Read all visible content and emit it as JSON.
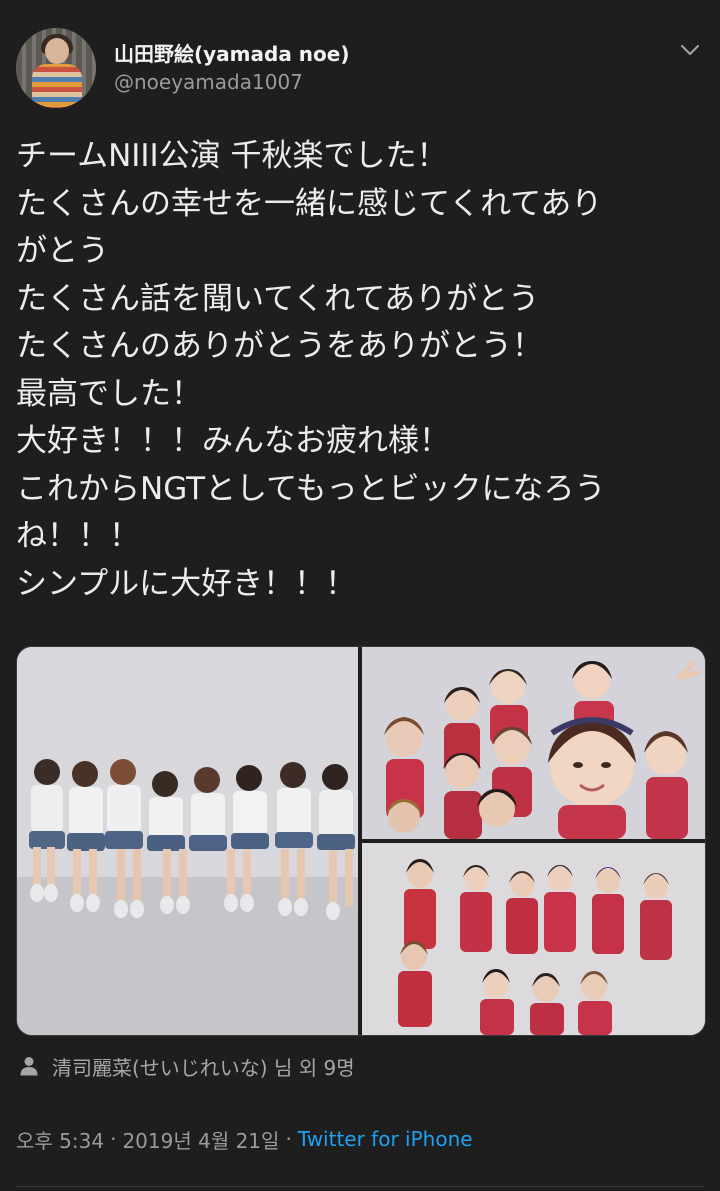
{
  "author": {
    "display_name": "山田野絵(yamada noe)",
    "handle": "@noeyamada1007"
  },
  "tweet": {
    "text": "チームNIII公演 千秋楽でした！\nたくさんの幸せを一緒に感じてくれてあり\nがとう\nたくさん話を聞いてくれてありがとう\nたくさんのありがとうをありがとう！\n最高でした！\n大好き！！！みんなお疲れ様！\nこれからNGTとしてもっとビックになろう\nね！！！\nシンプルに大好き！！！"
  },
  "media": {
    "photo_count": 3
  },
  "tagged": {
    "text": "清司麗菜(せいじれいな) 님 외 9명"
  },
  "footer": {
    "time": "오후 5:34",
    "date": "2019년 4월 21일",
    "separator": "·",
    "source": "Twitter for iPhone"
  },
  "colors": {
    "background": "#1e1e1e",
    "link": "#1da1f2",
    "muted": "#9a9a9a",
    "text": "#ececec"
  },
  "icons": [
    "chevron-down-icon",
    "person-icon"
  ]
}
